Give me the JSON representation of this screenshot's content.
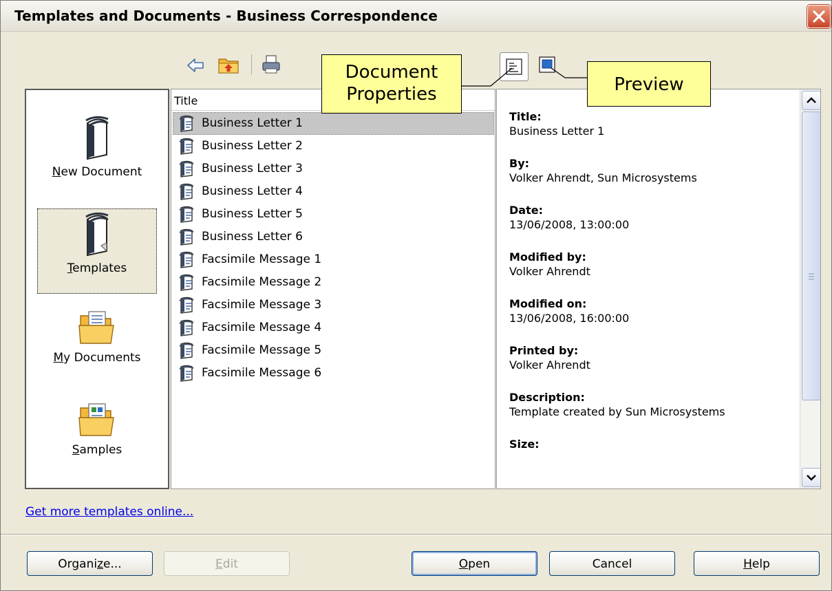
{
  "window": {
    "title": "Templates and Documents - Business Correspondence"
  },
  "categories": [
    {
      "label": "New Document",
      "accel": "N",
      "rest": "ew Document"
    },
    {
      "label": "Templates",
      "accel": "T",
      "rest": "emplates"
    },
    {
      "label": "My Documents",
      "accel": "M",
      "rest": "y Documents"
    },
    {
      "label": "Samples",
      "accel": "S",
      "rest": "amples"
    }
  ],
  "list": {
    "column_header": "Title",
    "items": [
      "Business Letter 1",
      "Business Letter 2",
      "Business Letter 3",
      "Business Letter 4",
      "Business Letter 5",
      "Business Letter 6",
      "Facsimile Message 1",
      "Facsimile Message 2",
      "Facsimile Message 3",
      "Facsimile Message 4",
      "Facsimile Message 5",
      "Facsimile Message 6"
    ],
    "selected_index": 0
  },
  "properties": [
    {
      "key": "Title:",
      "value": "Business Letter 1"
    },
    {
      "key": "By:",
      "value": "Volker Ahrendt, Sun Microsystems"
    },
    {
      "key": "Date:",
      "value": "13/06/2008, 13:00:00"
    },
    {
      "key": "Modified by:",
      "value": "Volker Ahrendt"
    },
    {
      "key": "Modified on:",
      "value": "13/06/2008, 16:00:00"
    },
    {
      "key": "Printed by:",
      "value": "Volker Ahrendt"
    },
    {
      "key": "Description:",
      "value": "Template created by Sun Microsystems"
    },
    {
      "key": "Size:",
      "value": ""
    }
  ],
  "callouts": {
    "document_properties_line1": "Document",
    "document_properties_line2": "Properties",
    "preview": "Preview"
  },
  "link": "Get more templates online...",
  "buttons": {
    "organize": {
      "accel": "z",
      "pre": "Organi",
      "post": "e..."
    },
    "edit": {
      "accel": "E",
      "pre": "",
      "post": "dit"
    },
    "open": {
      "accel": "O",
      "pre": "",
      "post": "pen"
    },
    "cancel": {
      "label": "Cancel"
    },
    "help": {
      "accel": "H",
      "pre": "",
      "post": "elp"
    }
  },
  "colors": {
    "callout_bg": "#ffff99",
    "link": "#0000ee",
    "selection": "#c6c6c6"
  }
}
